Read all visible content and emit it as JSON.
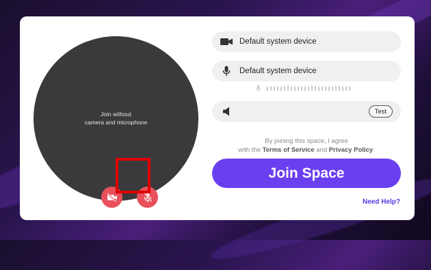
{
  "preview": {
    "message": "Join without\ncamera and microphone",
    "camera_icon": "camera-off-icon",
    "mic_icon": "mic-off-icon"
  },
  "devices": {
    "camera": {
      "icon": "video-camera-icon",
      "value": "Default system device"
    },
    "microphone": {
      "icon": "microphone-icon",
      "value": "Default system device"
    },
    "speaker": {
      "icon": "speaker-icon",
      "test_label": "Test"
    }
  },
  "agreement": {
    "line1": "By joining this space, I agree",
    "prefix": "with the ",
    "terms": "Terms of Service",
    "middle": " and ",
    "privacy": "Privacy Policy",
    "suffix": "."
  },
  "join_label": "Join Space",
  "help_label": "Need Help?",
  "colors": {
    "accent": "#6a3ff0",
    "muted_button": "#e8505b",
    "highlight": "#e00000"
  }
}
